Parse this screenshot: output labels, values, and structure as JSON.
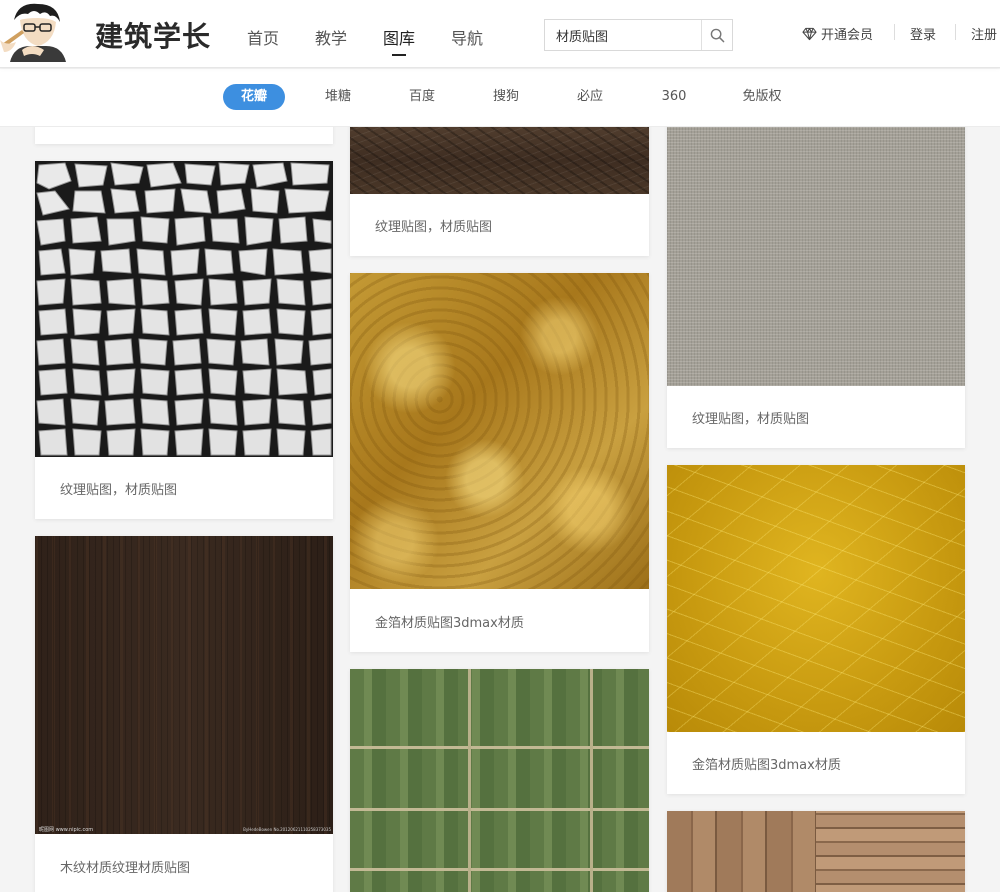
{
  "header": {
    "brand": "建筑学长",
    "nav": [
      {
        "label": "首页"
      },
      {
        "label": "教学"
      },
      {
        "label": "图库",
        "active": true
      },
      {
        "label": "导航"
      }
    ],
    "search": {
      "value": "材质贴图",
      "icon": "search-icon"
    },
    "vip_label": "开通会员",
    "vip_icon": "diamond-icon",
    "login_label": "登录",
    "register_label": "注册"
  },
  "subnav": {
    "items": [
      {
        "label": "花瓣",
        "active": true
      },
      {
        "label": "堆糖"
      },
      {
        "label": "百度"
      },
      {
        "label": "搜狗"
      },
      {
        "label": "必应"
      },
      {
        "label": "360"
      },
      {
        "label": "免版权"
      }
    ],
    "active_color": "#3d8fe0"
  },
  "grid": {
    "col1": [
      {
        "caption": "纹理贴图，材质贴图",
        "texture": "stone"
      },
      {
        "caption": "木纹材质纹理材质贴图",
        "texture": "dark-wood",
        "watermark_left": "昵图网 www.nipic.com",
        "watermark_right": "ByHedeBowen  No.20120621110258373035"
      }
    ],
    "col2": [
      {
        "caption": "纹理贴图，材质贴图",
        "texture": "leather"
      },
      {
        "caption": "金箔材质贴图3dmax材质",
        "texture": "gold-foil"
      },
      {
        "caption": "",
        "texture": "farmland"
      }
    ],
    "col3": [
      {
        "caption": "纹理贴图，材质贴图",
        "texture": "canvas"
      },
      {
        "caption": "金箔材质贴图3dmax材质",
        "texture": "gold-crackle"
      },
      {
        "caption": "",
        "texture": "wood-planks"
      }
    ]
  }
}
